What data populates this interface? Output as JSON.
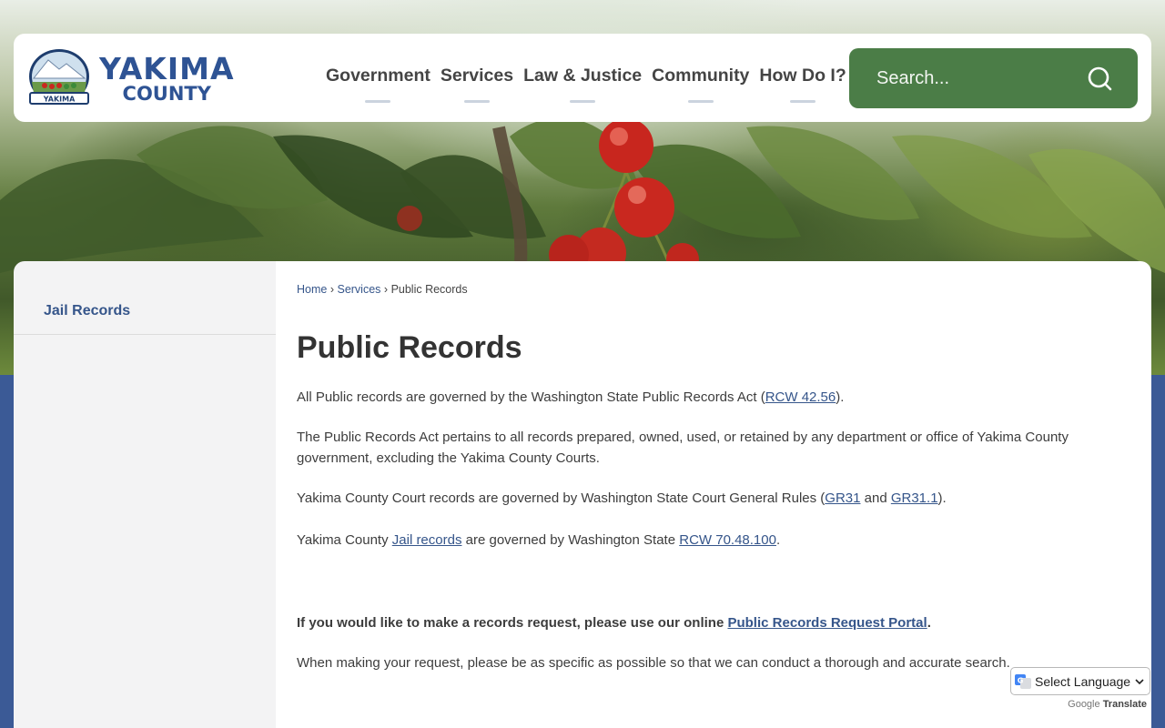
{
  "site": {
    "logo_word1": "YAKIMA",
    "logo_word2": "COUNTY",
    "logo_seal_text": "YAKIMA"
  },
  "nav": {
    "items": [
      {
        "label": "Government"
      },
      {
        "label": "Services"
      },
      {
        "label": "Law & Justice"
      },
      {
        "label": "Community"
      },
      {
        "label": "How Do I?"
      }
    ]
  },
  "search": {
    "placeholder": "Search..."
  },
  "sidebar": {
    "items": [
      {
        "label": "Jail Records"
      }
    ]
  },
  "breadcrumb": {
    "home": "Home",
    "sep1": "›",
    "services": "Services",
    "sep2": "›",
    "current": "Public Records"
  },
  "main": {
    "title": "Public Records",
    "p1_text": "All Public records are governed by the Washington State Public Records Act (",
    "p1_link": "RCW 42.56",
    "p1_end": ").",
    "p2_text": "The Public Records Act pertains to all records prepared, owned, used, or retained by any department or office of Yakima County government, excluding the Yakima County Courts.",
    "p3_text": "Yakima County Court records are governed by Washington State Court General Rules (",
    "p3_link1": "GR31",
    "p3_mid": " and ",
    "p3_link2": "GR31.1",
    "p3_end": ").",
    "p4_text": "Yakima County ",
    "p4_link1": "Jail records",
    "p4_mid": " are governed by Washington State ",
    "p4_link2": "RCW 70.48.100",
    "p4_end": ".",
    "p5_text": "If you would like to make a records request, please use our online ",
    "p5_link": "Public Records Request Portal",
    "p5_end": ".",
    "p6_text": "When making your request, please be as specific as possible so that we can conduct a thorough and accurate search."
  },
  "translate": {
    "select_label": "Select Language",
    "powered_google": "Google",
    "powered_translate": "Translate"
  },
  "colors": {
    "brand_blue": "#2e5394",
    "search_green": "#4b7d47",
    "link_blue": "#35558a",
    "band_blue": "#3b5a96"
  }
}
